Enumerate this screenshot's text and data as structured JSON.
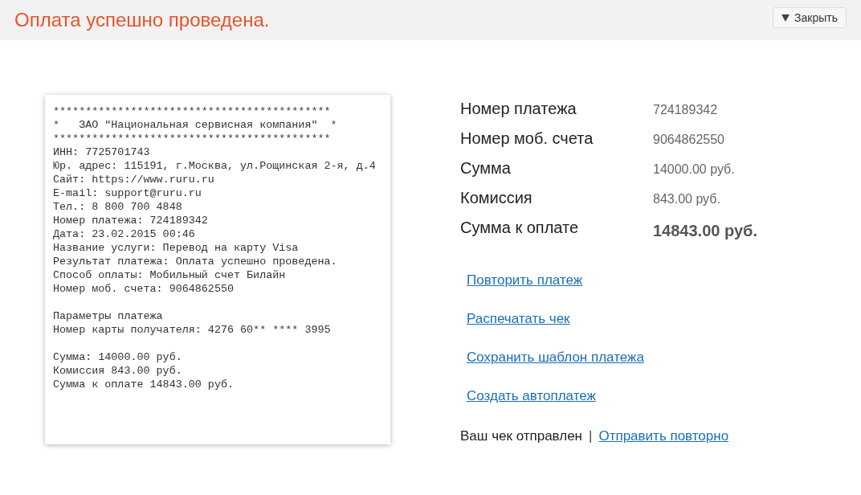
{
  "header": {
    "title": "Оплата успешно проведена.",
    "close_button": {
      "label": "Закрыть"
    }
  },
  "receipt": {
    "blocks": [
      {
        "lines": [
          "*******************************************",
          "*   ЗАО \"Национальная сервисная компания\"  *",
          "*******************************************",
          "ИНН: 7725701743",
          "Юр. адрес: 115191, г.Москва, ул.Рощинская 2-я, д.4",
          "Сайт: https://www.ruru.ru",
          "E-mail: support@ruru.ru",
          "Тел.: 8 800 700 4848",
          "Номер платежа: 724189342",
          "Дата: 23.02.2015 00:46",
          "Название услуги: Перевод на карту Visa",
          "Результат платежа: Оплата успешно проведена.",
          "Способ оплаты: Мобильный счет Билайн",
          "Номер моб. счета: 9064862550"
        ]
      },
      {
        "lines": [
          "Параметры платежа",
          "Номер карты получателя: 4276 60** **** 3995"
        ]
      },
      {
        "lines": [
          "Сумма: 14000.00 руб.",
          "Комиссия 843.00 руб.",
          "Сумма к оплате 14843.00 руб."
        ]
      }
    ]
  },
  "details": [
    {
      "label": "Номер платежа",
      "value": "724189342",
      "kind": "normal"
    },
    {
      "label": "Номер моб. счета",
      "value": "9064862550",
      "kind": "normal"
    },
    {
      "label": "Сумма",
      "value": "14000.00 руб.",
      "kind": "normal"
    },
    {
      "label": "Комиссия",
      "value": "843.00 руб.",
      "kind": "normal"
    },
    {
      "label": "Сумма к оплате",
      "value": "14843.00 руб.",
      "kind": "total"
    }
  ],
  "actions": [
    "Повторить платеж",
    "Распечатать чек",
    "Сохранить шаблон платежа",
    "Создать автоплатеж"
  ],
  "receipt_status": {
    "text": "Ваш чек отправлен",
    "separator": "|",
    "link": "Отправить повторно"
  }
}
